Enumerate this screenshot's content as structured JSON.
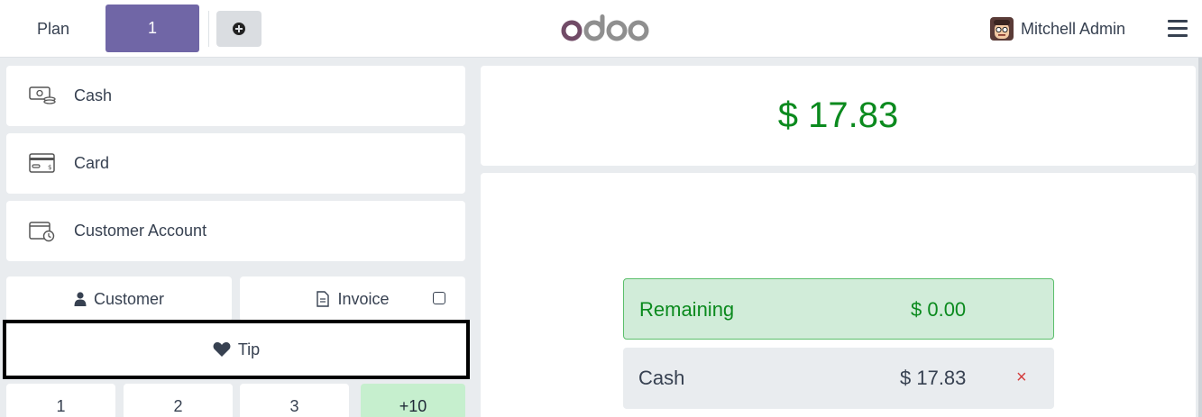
{
  "header": {
    "plan_label": "Plan",
    "active_tab": "1",
    "logo_text": "odoo",
    "user_name": "Mitchell Admin"
  },
  "payment_methods": [
    {
      "label": "Cash",
      "icon": "cash-icon"
    },
    {
      "label": "Card",
      "icon": "card-icon"
    },
    {
      "label": "Customer Account",
      "icon": "customer-account-icon"
    }
  ],
  "actions": {
    "customer_label": "Customer",
    "invoice_label": "Invoice",
    "invoice_checked": false,
    "tip_label": "Tip"
  },
  "numpad": [
    "1",
    "2",
    "3",
    "+10"
  ],
  "summary": {
    "total": "$ 17.83",
    "remaining_label": "Remaining",
    "remaining_value": "$ 0.00",
    "payment_line_label": "Cash",
    "payment_line_value": "$ 17.83",
    "remove_symbol": "×"
  },
  "colors": {
    "brand": "#7066a6",
    "success": "#0b8a1e",
    "remaining_bg": "#d1ecd9",
    "delete": "#d43d3d"
  }
}
